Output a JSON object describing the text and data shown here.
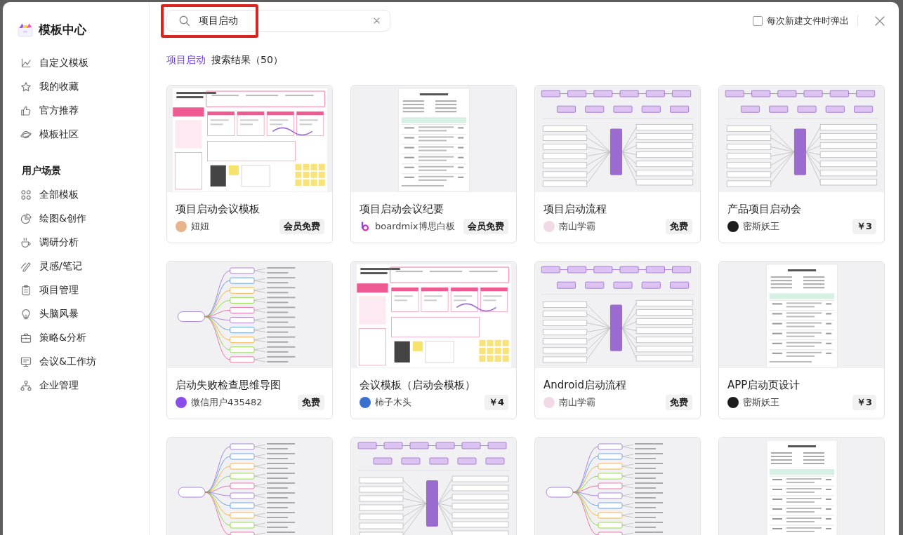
{
  "sidebar": {
    "title": "模板中心",
    "items": [
      {
        "label": "自定义模板",
        "selected": false
      },
      {
        "label": "我的收藏",
        "selected": false
      },
      {
        "label": "官方推荐",
        "selected": false
      },
      {
        "label": "模板社区",
        "selected": false
      }
    ],
    "scenes": {
      "title": "用户场景",
      "items": [
        {
          "label": "全部模板",
          "selected": false
        },
        {
          "label": "绘图&创作",
          "selected": false
        },
        {
          "label": "调研分析",
          "selected": false
        },
        {
          "label": "灵感/笔记",
          "selected": false
        },
        {
          "label": "项目管理",
          "selected": false
        },
        {
          "label": "头脑风暴",
          "selected": false
        },
        {
          "label": "策略&分析",
          "selected": false
        },
        {
          "label": "会议&工作坊",
          "selected": false
        },
        {
          "label": "企业管理",
          "selected": false
        }
      ]
    }
  },
  "search": {
    "value": "项目启动",
    "highlighted": true
  },
  "popup_option": {
    "label": "每次新建文件时弹出",
    "checked": false
  },
  "results": {
    "keyword": "项目启动",
    "label": "搜索结果（50）"
  },
  "cards": [
    {
      "title": "项目启动会议模板",
      "author": "妞妞",
      "avatar": {
        "kind": "photo",
        "color": "#e8b48c"
      },
      "price": "会员免费",
      "preview": {
        "kind": "board"
      }
    },
    {
      "title": "项目启动会议纪要",
      "author": "boardmix博思白板",
      "avatar": {
        "kind": "logo"
      },
      "price": "会员免费",
      "preview": {
        "kind": "document"
      }
    },
    {
      "title": "项目启动流程",
      "author": "南山学霸",
      "avatar": {
        "kind": "photo",
        "color": "#f1d9e6"
      },
      "price": "免费",
      "preview": {
        "kind": "flowchart"
      }
    },
    {
      "title": "产品项目启动会",
      "author": "密斯妖王",
      "avatar": {
        "kind": "photo",
        "color": "#1c1c1c"
      },
      "price": "￥3",
      "preview": {
        "kind": "flowchart"
      }
    },
    {
      "title": "启动失败检查思维导图",
      "author": "微信用户435482",
      "avatar": {
        "kind": "photo",
        "color": "#8b4dea"
      },
      "price": "免费",
      "preview": {
        "kind": "mindmap"
      }
    },
    {
      "title": "会议模板（启动会模板）",
      "author": "柿子木头",
      "avatar": {
        "kind": "photo",
        "color": "#3a6fd0"
      },
      "price": "￥4",
      "preview": {
        "kind": "board"
      }
    },
    {
      "title": "Android启动流程",
      "author": "南山学霸",
      "avatar": {
        "kind": "photo",
        "color": "#f1d9e6"
      },
      "price": "免费",
      "preview": {
        "kind": "flowchart"
      }
    },
    {
      "title": "APP启动页设计",
      "author": "密斯妖王",
      "avatar": {
        "kind": "photo",
        "color": "#1c1c1c"
      },
      "price": "￥3",
      "preview": {
        "kind": "document"
      }
    },
    {
      "preview": {
        "kind": "mindmap"
      }
    },
    {
      "preview": {
        "kind": "flowchart"
      }
    },
    {
      "preview": {
        "kind": "mindmap"
      }
    },
    {
      "preview": {
        "kind": "document"
      }
    }
  ]
}
